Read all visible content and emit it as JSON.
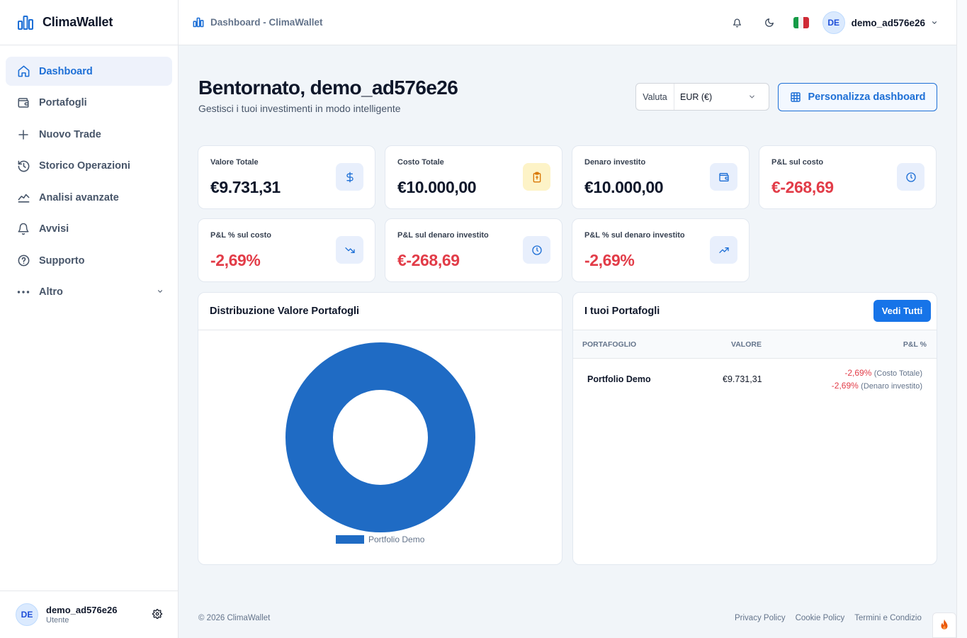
{
  "app": {
    "name": "ClimaWallet",
    "brand_color": "#1d6fd6"
  },
  "sidebar": {
    "items": [
      {
        "label": "Dashboard",
        "icon": "home-icon",
        "active": true
      },
      {
        "label": "Portafogli",
        "icon": "wallet-icon"
      },
      {
        "label": "Nuovo Trade",
        "icon": "plus-icon"
      },
      {
        "label": "Storico Operazioni",
        "icon": "history-icon"
      },
      {
        "label": "Analisi avanzate",
        "icon": "chart-line-icon"
      },
      {
        "label": "Avvisi",
        "icon": "bell-icon"
      },
      {
        "label": "Supporto",
        "icon": "help-icon"
      },
      {
        "label": "Altro",
        "icon": "more-icon"
      }
    ],
    "user": {
      "initials": "DE",
      "name": "demo_ad576e26",
      "role": "Utente"
    }
  },
  "topbar": {
    "breadcrumb": "Dashboard - ClimaWallet",
    "user": {
      "initials": "DE",
      "name": "demo_ad576e26"
    }
  },
  "header": {
    "title": "Bentornato, demo_ad576e26",
    "subtitle": "Gestisci i tuoi investimenti in modo intelligente",
    "currency_label": "Valuta",
    "currency_value": "EUR (€)",
    "customize_label": "Personalizza dashboard"
  },
  "stats": [
    {
      "label": "Valore Totale",
      "value": "€9.731,31",
      "negative": false,
      "icon": "dollar-icon"
    },
    {
      "label": "Costo Totale",
      "value": "€10.000,00",
      "negative": false,
      "icon": "clipboard-icon"
    },
    {
      "label": "Denaro investito",
      "value": "€10.000,00",
      "negative": false,
      "icon": "wallet-icon"
    },
    {
      "label": "P&L sul costo",
      "value": "€-268,69",
      "negative": true,
      "icon": "clock-icon"
    },
    {
      "label": "P&L % sul costo",
      "value": "-2,69%",
      "negative": true,
      "icon": "trending-down-icon"
    },
    {
      "label": "P&L sul denaro investito",
      "value": "€-268,69",
      "negative": true,
      "icon": "clock-icon"
    },
    {
      "label": "P&L % sul denaro investito",
      "value": "-2,69%",
      "negative": true,
      "icon": "trending-up-icon"
    }
  ],
  "distribution": {
    "title": "Distribuzione Valore Portafogli",
    "chart_data": {
      "type": "pie",
      "categories": [
        "Portfolio Demo"
      ],
      "values": [
        100
      ],
      "colors": [
        "#1f6bc4"
      ],
      "donut": true,
      "legend": "bottom"
    }
  },
  "portfolios": {
    "title": "I tuoi Portafogli",
    "see_all": "Vedi Tutti",
    "columns": [
      "PORTAFOGLIO",
      "VALORE",
      "P&L %"
    ],
    "rows": [
      {
        "name": "Portfolio Demo",
        "value": "€9.731,31",
        "pl_cost": "-2,69%",
        "pl_cost_note": "(Costo Totale)",
        "pl_invested": "-2,69%",
        "pl_invested_note": "(Denaro investito)"
      }
    ]
  },
  "footer": {
    "copyright": "© 2026 ClimaWallet",
    "links": [
      "Privacy Policy",
      "Cookie Policy",
      "Termini e Condizio"
    ]
  },
  "colors": {
    "negative": "#e23c48",
    "accent": "#1774e8"
  }
}
